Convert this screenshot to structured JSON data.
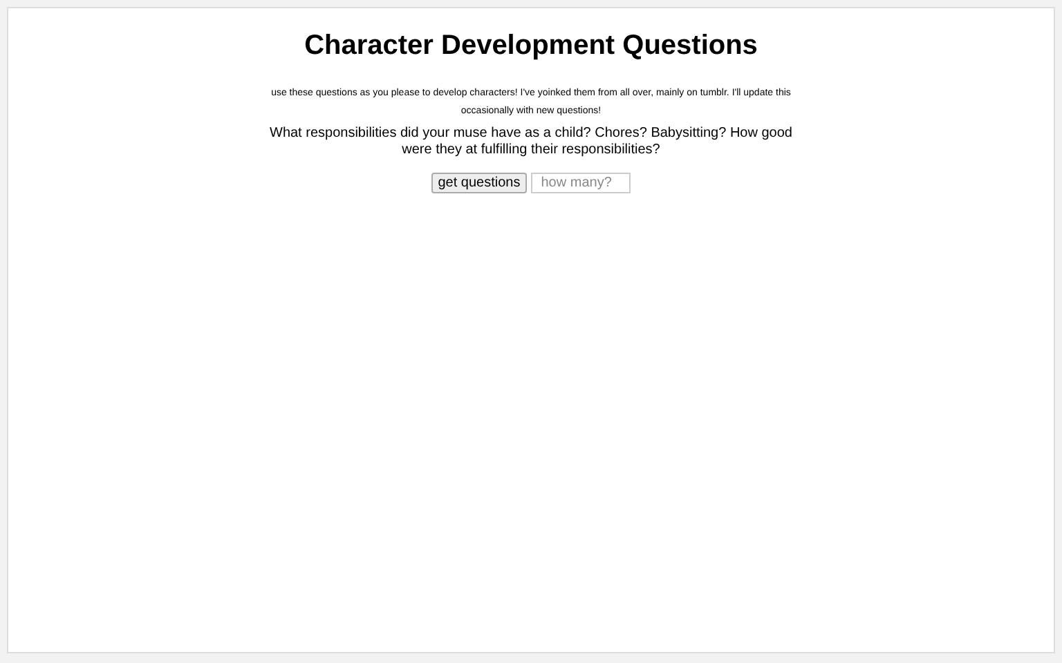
{
  "title": "Character Development Questions",
  "intro": "use these questions as you please to develop characters! I've yoinked them from all over, mainly on tumblr. I'll update this occasionally with new questions!",
  "question": "What responsibilities did your muse have as a child? Chores? Babysitting? How good were they at fulfilling their responsibilities?",
  "button": "get questions",
  "count_field": {
    "placeholder": "how many?"
  }
}
